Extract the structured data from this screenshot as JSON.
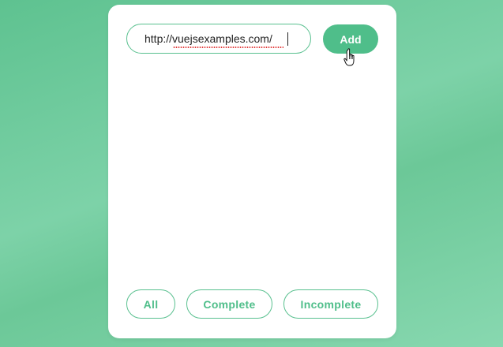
{
  "todo_input": {
    "value": "http://vuejsexamples.com/"
  },
  "add_button": {
    "label": "Add"
  },
  "filters": [
    {
      "label": "All"
    },
    {
      "label": "Complete"
    },
    {
      "label": "Incomplete"
    }
  ],
  "colors": {
    "accent": "#4fbe8a",
    "background": "#6cc898",
    "card": "#ffffff"
  },
  "icons": {
    "pointer": "hand-pointer-cursor-icon"
  }
}
